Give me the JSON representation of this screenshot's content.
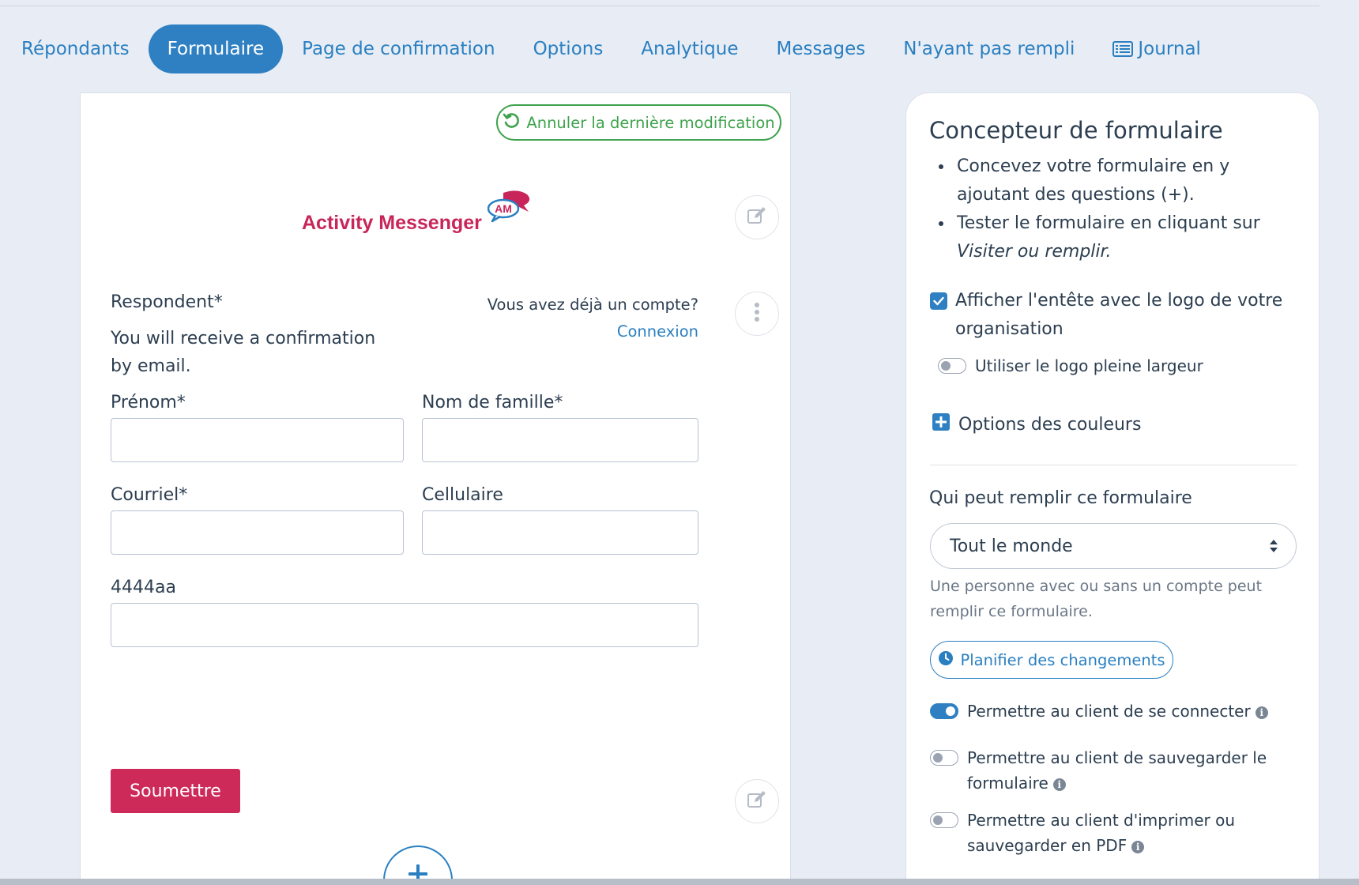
{
  "tabs": [
    {
      "label": "Répondants",
      "active": false
    },
    {
      "label": "Formulaire",
      "active": true
    },
    {
      "label": "Page de confirmation",
      "active": false
    },
    {
      "label": "Options",
      "active": false
    },
    {
      "label": "Analytique",
      "active": false
    },
    {
      "label": "Messages",
      "active": false
    },
    {
      "label": "N'ayant pas rempli",
      "active": false
    },
    {
      "label": "Journal",
      "active": false,
      "icon": "list-icon"
    }
  ],
  "form": {
    "undo_label": "Annuler la dernière modification",
    "logo_text": "Activity Messenger",
    "logo_badge": "AM",
    "section_title": "Respondent*",
    "section_subtitle": "You will receive a confirmation by email.",
    "account_question": "Vous avez déjà un compte?",
    "login_link": "Connexion",
    "fields": {
      "first_name": {
        "label": "Prénom*",
        "value": ""
      },
      "last_name": {
        "label": "Nom de famille*",
        "value": ""
      },
      "email": {
        "label": "Courriel*",
        "value": ""
      },
      "cell": {
        "label": "Cellulaire",
        "value": ""
      },
      "custom": {
        "label": "4444aa",
        "value": ""
      }
    },
    "submit_label": "Soumettre"
  },
  "side": {
    "title": "Concepteur de formulaire",
    "bullet1": "Concevez votre formulaire en y ajoutant des questions (+).",
    "bullet2_prefix": "Tester le formulaire en cliquant sur ",
    "bullet2_em": "Visiter ou remplir.",
    "show_header_label": "Afficher l'entête avec le logo de votre organisation",
    "show_header_checked": true,
    "full_logo_label": "Utiliser le logo pleine largeur",
    "full_logo_on": false,
    "color_options_label": "Options des couleurs",
    "who_can_fill_label": "Qui peut remplir ce formulaire",
    "who_can_fill_value": "Tout le monde",
    "who_can_fill_help": "Une personne avec ou sans un compte peut remplir ce formulaire.",
    "schedule_label": "Planifier des changements",
    "allow_login_label": "Permettre au client de se connecter",
    "allow_login_on": true,
    "allow_save_label": "Permettre au client de sauvegarder le formulaire",
    "allow_save_on": false,
    "allow_print_label": "Permettre au client d'imprimer ou sauvegarder en PDF",
    "allow_print_on": false
  },
  "colors": {
    "accent": "#2f80c3",
    "brand": "#c8265a",
    "success": "#3fa34d",
    "submit": "#cd2a5a"
  }
}
